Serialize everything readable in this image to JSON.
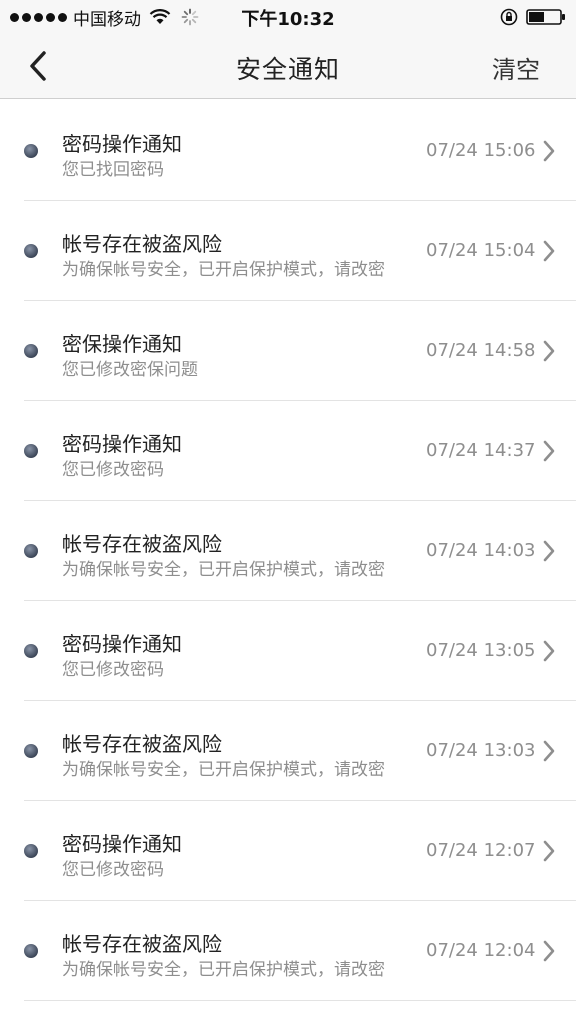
{
  "status_bar": {
    "carrier": "中国移动",
    "time": "下午10:32",
    "icons": [
      "signal-dots-icon",
      "wifi-icon",
      "activity-spinner-icon",
      "rotation-lock-icon",
      "battery-icon"
    ]
  },
  "nav": {
    "title": "安全通知",
    "clear_label": "清空",
    "back_icon": "chevron-left-icon"
  },
  "notifications": [
    {
      "title": "密码操作通知",
      "desc": "您已找回密码",
      "time": "07/24 15:06"
    },
    {
      "title": "帐号存在被盗风险",
      "desc": "为确保帐号安全，已开启保护模式，请改密",
      "time": "07/24 15:04"
    },
    {
      "title": "密保操作通知",
      "desc": "您已修改密保问题",
      "time": "07/24 14:58"
    },
    {
      "title": "密码操作通知",
      "desc": "您已修改密码",
      "time": "07/24 14:37"
    },
    {
      "title": "帐号存在被盗风险",
      "desc": "为确保帐号安全，已开启保护模式，请改密",
      "time": "07/24 14:03"
    },
    {
      "title": "密码操作通知",
      "desc": "您已修改密码",
      "time": "07/24 13:05"
    },
    {
      "title": "帐号存在被盗风险",
      "desc": "为确保帐号安全，已开启保护模式，请改密",
      "time": "07/24 13:03"
    },
    {
      "title": "密码操作通知",
      "desc": "您已修改密码",
      "time": "07/24 12:07"
    },
    {
      "title": "帐号存在被盗风险",
      "desc": "为确保帐号安全，已开启保护模式，请改密",
      "time": "07/24 12:04"
    }
  ],
  "colors": {
    "bar_background": "#f7f7f7",
    "text_primary": "#222222",
    "text_secondary": "#8e8e8e",
    "dot": "#3c4658"
  }
}
